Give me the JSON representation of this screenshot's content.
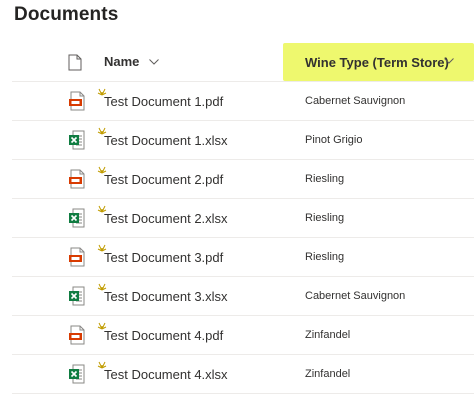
{
  "library": {
    "title": "Documents"
  },
  "header": {
    "name_label": "Name",
    "wine_type_label": "Wine Type (Term Store)",
    "highlight_color": "#eef86e"
  },
  "icons": {
    "file_type_header": "document-icon",
    "pdf": "pdf-file-icon",
    "xlsx": "excel-file-icon",
    "new": "new-item-sparkle-icon",
    "sort": "chevron-down-icon"
  },
  "colors": {
    "pdf_accent": "#d83b01",
    "excel_accent": "#107c41",
    "new_sparkle": "#c19c00"
  },
  "rows": [
    {
      "name": "Test Document 1.pdf",
      "type": "pdf",
      "wine_type": "Cabernet Sauvignon"
    },
    {
      "name": "Test Document 1.xlsx",
      "type": "xlsx",
      "wine_type": "Pinot Grigio"
    },
    {
      "name": "Test Document 2.pdf",
      "type": "pdf",
      "wine_type": "Riesling"
    },
    {
      "name": "Test Document 2.xlsx",
      "type": "xlsx",
      "wine_type": "Riesling"
    },
    {
      "name": "Test Document 3.pdf",
      "type": "pdf",
      "wine_type": "Riesling"
    },
    {
      "name": "Test Document 3.xlsx",
      "type": "xlsx",
      "wine_type": "Cabernet Sauvignon"
    },
    {
      "name": "Test Document 4.pdf",
      "type": "pdf",
      "wine_type": "Zinfandel"
    },
    {
      "name": "Test Document 4.xlsx",
      "type": "xlsx",
      "wine_type": "Zinfandel"
    }
  ]
}
